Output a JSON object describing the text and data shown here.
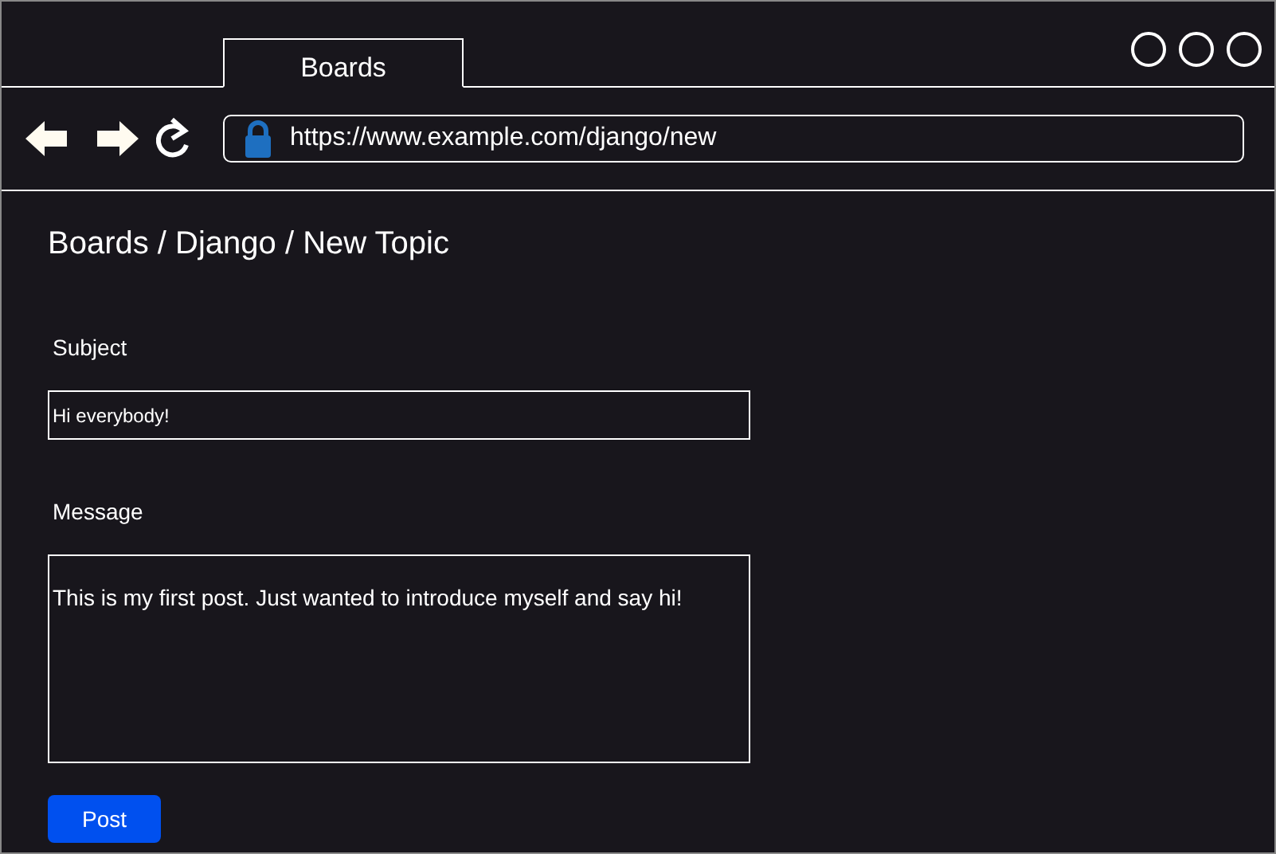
{
  "tabs": [
    {
      "label": "Boards",
      "selected": true
    }
  ],
  "address_bar": {
    "url": "https://www.example.com/django/new"
  },
  "breadcrumb": "Boards / Django / New Topic",
  "form": {
    "fields": [
      {
        "kind": "input",
        "label": "Subject",
        "value": "Hi everybody!"
      },
      {
        "kind": "textarea",
        "label": "Message",
        "value": "This is my first post. Just wanted to introduce myself and say hi!"
      }
    ],
    "submit": "Post"
  }
}
